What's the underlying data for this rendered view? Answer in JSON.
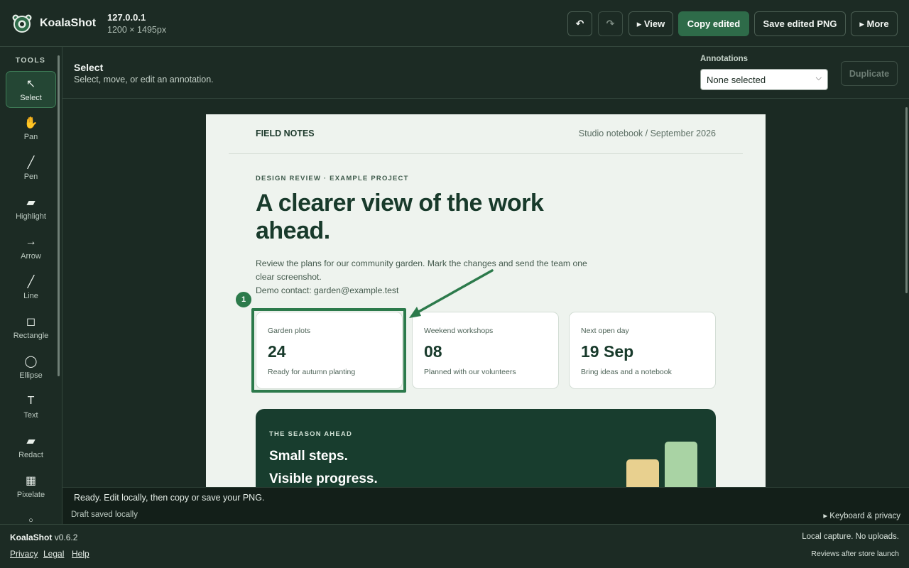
{
  "app": {
    "name": "KoalaShot",
    "host": "127.0.0.1",
    "dimensions": "1200 × 1495px",
    "accent_color": "#2e6b49"
  },
  "toolbar": {
    "undo_icon": "undo-icon",
    "redo_icon": "redo-icon",
    "view_label": "▸ View",
    "copy_label": "Copy edited",
    "save_label": "Save edited PNG",
    "more_label": "▸ More"
  },
  "sidebar": {
    "title": "TOOLS",
    "tools": [
      {
        "label": "Select",
        "icon": "↖",
        "icon_name": "select-cursor-icon",
        "active": true
      },
      {
        "label": "Pan",
        "icon": "✋",
        "icon_name": "hand-icon",
        "active": false
      },
      {
        "label": "Pen",
        "icon": "╱",
        "icon_name": "pen-icon",
        "active": false
      },
      {
        "label": "Highlight",
        "icon": "▰",
        "icon_name": "highlight-icon",
        "active": false
      },
      {
        "label": "Arrow",
        "icon": "→",
        "icon_name": "arrow-icon",
        "active": false
      },
      {
        "label": "Line",
        "icon": "╱",
        "icon_name": "line-icon",
        "active": false
      },
      {
        "label": "Rectangle",
        "icon": "◻",
        "icon_name": "rectangle-icon",
        "active": false
      },
      {
        "label": "Ellipse",
        "icon": "◯",
        "icon_name": "ellipse-icon",
        "active": false
      },
      {
        "label": "Text",
        "icon": "T",
        "icon_name": "text-icon",
        "active": false
      },
      {
        "label": "Redact",
        "icon": "▰",
        "icon_name": "redact-icon",
        "active": false
      },
      {
        "label": "Pixelate",
        "icon": "▦",
        "icon_name": "pixelate-icon",
        "active": false
      }
    ]
  },
  "context": {
    "title": "Select",
    "description": "Select, move, or edit an annotation.",
    "annotations_label": "Annotations",
    "annotations_selected": "None selected",
    "duplicate_label": "Duplicate"
  },
  "document": {
    "brand": "FIELD NOTES",
    "meta": "Studio notebook / September 2026",
    "eyebrow": "DESIGN REVIEW · EXAMPLE PROJECT",
    "headline": "A clearer view of the work ahead.",
    "lede_line1": "Review the plans for our community garden. Mark the changes and send the team one clear screenshot.",
    "lede_line2": "Demo contact: garden@example.test",
    "cards": [
      {
        "label": "Garden plots",
        "value": "24",
        "note": "Ready for autumn planting"
      },
      {
        "label": "Weekend workshops",
        "value": "08",
        "note": "Planned with our volunteers"
      },
      {
        "label": "Next open day",
        "value": "19 Sep",
        "note": "Bring ideas and a notebook"
      }
    ],
    "season": {
      "eyebrow": "THE SEASON AHEAD",
      "line1": "Small steps.",
      "line2": "Visible progress.",
      "bar_colors": [
        "#e8d08f",
        "#a9d3a4"
      ]
    }
  },
  "annotation": {
    "badge": "1",
    "color": "#2c7a4b"
  },
  "status": {
    "message": "Ready. Edit locally, then copy or save your PNG.",
    "draft": "Draft saved locally",
    "keyboard": "▸ Keyboard & privacy"
  },
  "footer": {
    "brand": "KoalaShot",
    "version": "v0.6.2",
    "links": [
      "Privacy",
      "Legal",
      "Help"
    ],
    "tagline": "Local capture. No uploads.",
    "reviews": "Reviews after store launch"
  }
}
